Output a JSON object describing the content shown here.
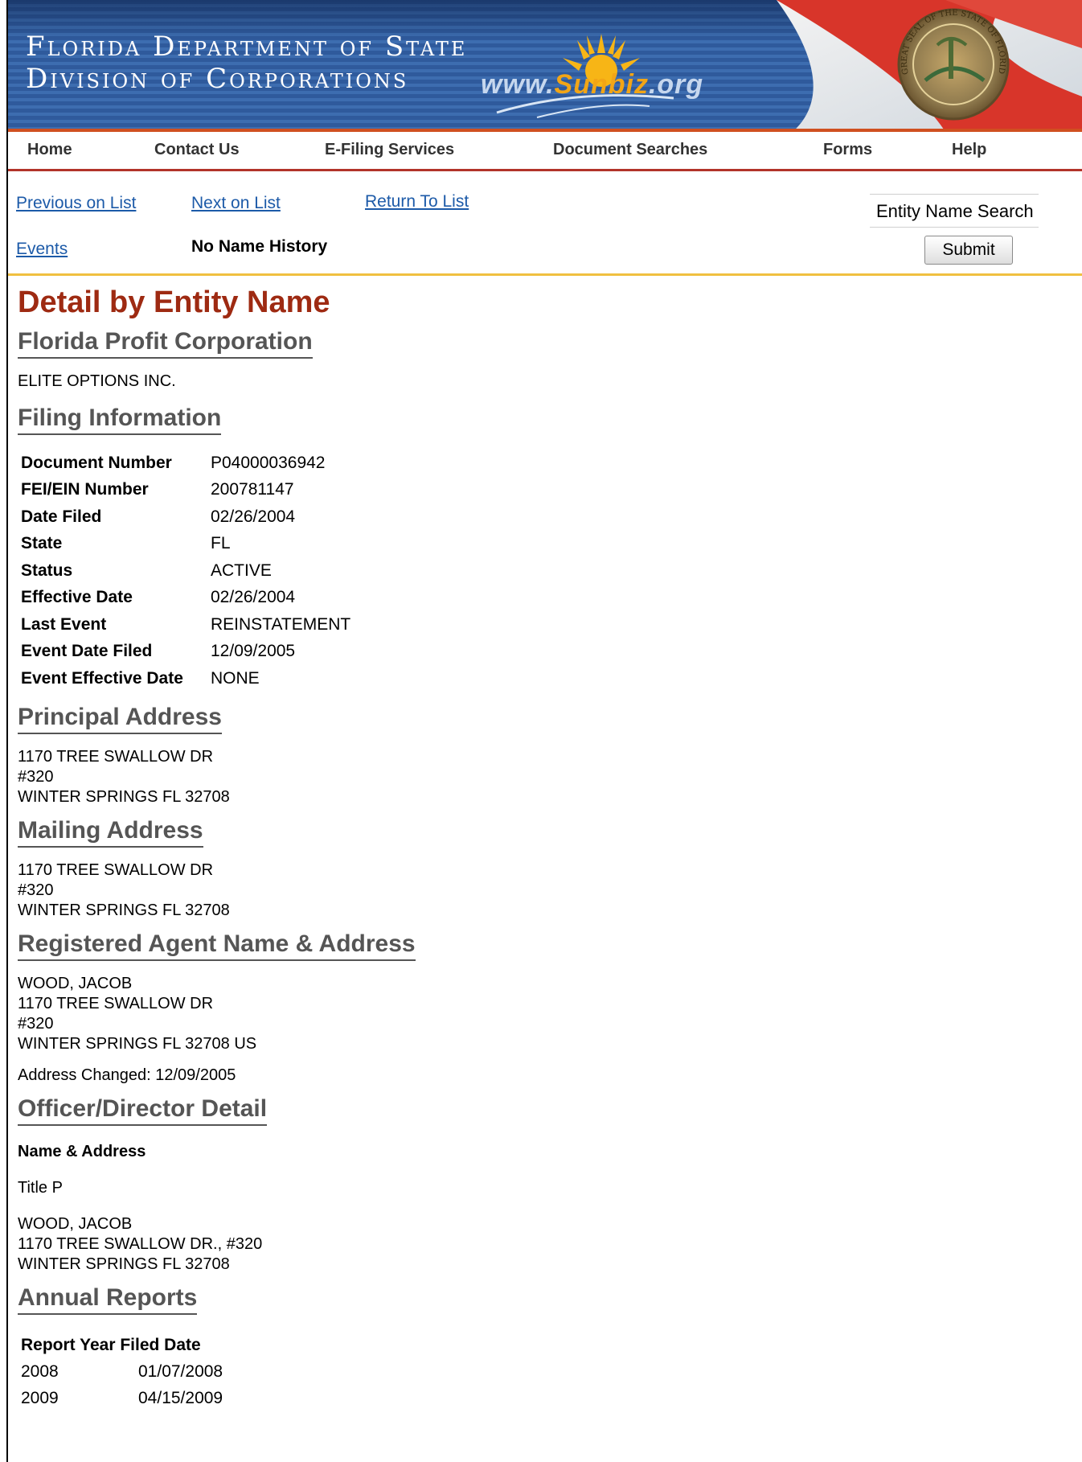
{
  "banner": {
    "title_line1": "Florida Department of State",
    "title_line2": "Division of Corporations",
    "sunbiz_prefix": "www.",
    "sunbiz_brand": "Sunbiz",
    "sunbiz_suffix": ".org",
    "seal_text": "GREAT SEAL OF THE STATE OF FLORIDA"
  },
  "nav": {
    "home": "Home",
    "contact": "Contact Us",
    "efiling": "E-Filing Services",
    "docsearch": "Document Searches",
    "forms": "Forms",
    "help": "Help"
  },
  "subnav": {
    "previous": "Previous on List",
    "next": "Next on List",
    "return": "Return To List",
    "events": "Events",
    "no_name_history": "No Name History",
    "search_label": "Entity Name Search",
    "submit": "Submit"
  },
  "detail": {
    "title": "Detail by Entity Name",
    "corp_type": "Florida Profit Corporation",
    "entity_name": "ELITE OPTIONS INC."
  },
  "filing": {
    "heading": "Filing Information",
    "rows": [
      {
        "label": "Document Number",
        "value": "P04000036942"
      },
      {
        "label": "FEI/EIN Number",
        "value": "200781147"
      },
      {
        "label": "Date Filed",
        "value": "02/26/2004"
      },
      {
        "label": "State",
        "value": "FL"
      },
      {
        "label": "Status",
        "value": "ACTIVE"
      },
      {
        "label": "Effective Date",
        "value": "02/26/2004"
      },
      {
        "label": "Last Event",
        "value": "REINSTATEMENT"
      },
      {
        "label": "Event Date Filed",
        "value": "12/09/2005"
      },
      {
        "label": "Event Effective Date",
        "value": "NONE"
      }
    ]
  },
  "principal": {
    "heading": "Principal Address",
    "lines": [
      "1170 TREE SWALLOW DR",
      "#320",
      "WINTER SPRINGS FL 32708"
    ]
  },
  "mailing": {
    "heading": "Mailing Address",
    "lines": [
      "1170 TREE SWALLOW DR",
      "#320",
      "WINTER SPRINGS FL 32708"
    ]
  },
  "agent": {
    "heading": "Registered Agent Name & Address",
    "lines": [
      "WOOD, JACOB",
      "1170 TREE SWALLOW DR",
      "#320",
      "WINTER SPRINGS FL 32708 US"
    ],
    "changed": "Address Changed: 12/09/2005"
  },
  "officer": {
    "heading": "Officer/Director Detail",
    "subheading": "Name & Address",
    "title": "Title P",
    "lines": [
      "WOOD, JACOB",
      "1170 TREE SWALLOW DR., #320",
      "WINTER SPRINGS FL 32708"
    ]
  },
  "annual": {
    "heading": "Annual Reports",
    "col_year": "Report Year",
    "col_date": "Filed Date",
    "rows": [
      {
        "year": "2008",
        "date": "01/07/2008"
      },
      {
        "year": "2009",
        "date": "04/15/2009"
      }
    ]
  },
  "colors": {
    "title_red": "#9e2a12",
    "link_blue": "#1c5aa8",
    "banner_blue": "#2f5a9c",
    "nav_rule": "#b2342a",
    "subnav_rule": "#f0c040"
  }
}
